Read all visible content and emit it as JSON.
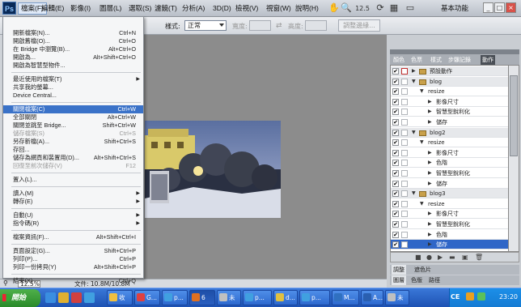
{
  "app": {
    "logo": "Ps",
    "zoom": "12.5",
    "workspace": "基本功能"
  },
  "menubar": [
    "檔案(F)",
    "編輯(E)",
    "影像(I)",
    "圖層(L)",
    "選取(S)",
    "濾鏡(T)",
    "分析(A)",
    "3D(D)",
    "檢視(V)",
    "視窗(W)",
    "說明(H)"
  ],
  "options": {
    "style_label": "樣式:",
    "style_value": "正常",
    "width_label": "寬度:",
    "height_label": "高度:",
    "refine_button": "調整邊緣..."
  },
  "file_menu": [
    {
      "label": "開新檔案(N)...",
      "shortcut": "Ctrl+N"
    },
    {
      "label": "開啟舊檔(O)...",
      "shortcut": "Ctrl+O"
    },
    {
      "label": "在 Bridge 中瀏覽(B)...",
      "shortcut": "Alt+Ctrl+O"
    },
    {
      "label": "開啟為...",
      "shortcut": "Alt+Shift+Ctrl+O"
    },
    {
      "label": "開啟為智慧型物件...",
      "shortcut": ""
    },
    {
      "label": "最近使用的檔案(T)",
      "shortcut": "",
      "submenu": true
    },
    {
      "label": "共享我的螢幕...",
      "shortcut": ""
    },
    {
      "label": "Device Central...",
      "shortcut": ""
    },
    {
      "label": "關閉檔案(C)",
      "shortcut": "Ctrl+W",
      "highlight": true
    },
    {
      "label": "全部關閉",
      "shortcut": "Alt+Ctrl+W"
    },
    {
      "label": "關閉並跳至 Bridge...",
      "shortcut": "Shift+Ctrl+W"
    },
    {
      "label": "儲存檔案(S)",
      "shortcut": "Ctrl+S",
      "dim": true
    },
    {
      "label": "另存新檔(A)...",
      "shortcut": "Shift+Ctrl+S"
    },
    {
      "label": "存回...",
      "shortcut": ""
    },
    {
      "label": "儲存為網頁和裝置用(D)...",
      "shortcut": "Alt+Shift+Ctrl+S"
    },
    {
      "label": "回復至前次儲存(V)",
      "shortcut": "F12",
      "dim": true
    },
    {
      "label": "置入(L)...",
      "shortcut": ""
    },
    {
      "label": "讀入(M)",
      "shortcut": "",
      "submenu": true
    },
    {
      "label": "轉存(E)",
      "shortcut": "",
      "submenu": true
    },
    {
      "label": "自動(U)",
      "shortcut": "",
      "submenu": true
    },
    {
      "label": "指令碼(R)",
      "shortcut": "",
      "submenu": true
    },
    {
      "label": "檔案資訊(F)...",
      "shortcut": "Alt+Shift+Ctrl+I"
    },
    {
      "label": "頁面設定(G)...",
      "shortcut": "Shift+Ctrl+P"
    },
    {
      "label": "列印(P)...",
      "shortcut": "Ctrl+P"
    },
    {
      "label": "列印一份拷貝(Y)",
      "shortcut": "Alt+Shift+Ctrl+P"
    },
    {
      "label": "結束(X)",
      "shortcut": "Ctrl+Q"
    }
  ],
  "panel_tabs": [
    "顏色",
    "色票",
    "樣式",
    "步驟記錄",
    "動作"
  ],
  "actions": [
    {
      "label": "預設動作",
      "type": "set"
    },
    {
      "label": "blog",
      "type": "set"
    },
    {
      "label": "resize",
      "type": "action"
    },
    {
      "label": "影像尺寸",
      "type": "step"
    },
    {
      "label": "智慧型銳利化",
      "type": "step"
    },
    {
      "label": "儲存",
      "type": "step"
    },
    {
      "label": "blog2",
      "type": "set"
    },
    {
      "label": "resize",
      "type": "action"
    },
    {
      "label": "影像尺寸",
      "type": "step"
    },
    {
      "label": "色階",
      "type": "step"
    },
    {
      "label": "智慧型銳利化",
      "type": "step"
    },
    {
      "label": "儲存",
      "type": "step"
    },
    {
      "label": "blog3",
      "type": "set"
    },
    {
      "label": "resize",
      "type": "action"
    },
    {
      "label": "影像尺寸",
      "type": "step"
    },
    {
      "label": "智慧型銳利化",
      "type": "step"
    },
    {
      "label": "色階",
      "type": "step"
    },
    {
      "label": "儲存",
      "type": "step",
      "selected": true
    }
  ],
  "bottom_tabs_1": [
    "調整",
    "遮色片"
  ],
  "bottom_tabs_2": [
    "圖層",
    "色版",
    "路徑"
  ],
  "status": {
    "zoom": "12.5%",
    "doc": "文件: 10.8M/10.8M"
  },
  "taskbar": {
    "start": "開始",
    "buttons": [
      "收",
      "G...",
      "p...",
      "6",
      "未",
      "p...",
      "d...",
      "p...",
      "M...",
      "A...",
      "未"
    ],
    "ime": "CE",
    "clock": "23:20"
  },
  "colors": {
    "highlight": "#3a72c8",
    "taskbar": "#245edb",
    "start": "#3c9a3c"
  }
}
